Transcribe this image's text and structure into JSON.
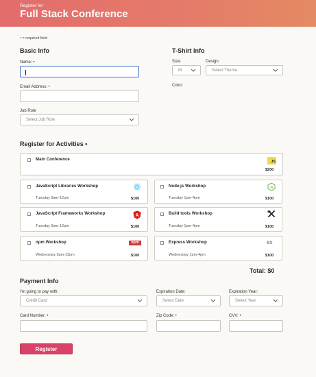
{
  "header": {
    "sup": "Register for",
    "title": "Full Stack Conference"
  },
  "required_note": "• = required field",
  "basic_info": {
    "heading": "Basic Info",
    "name_label": "Name: •",
    "name_value": "",
    "email_label": "Email Address: •",
    "email_value": "",
    "job_role_label": "Job Role",
    "job_role_selected": "Select Job Role"
  },
  "tshirt": {
    "heading": "T-Shirt Info",
    "size_label": "Size:",
    "size_selected": "M",
    "design_label": "Design:",
    "design_selected": "Select Theme",
    "color_label": "Color:"
  },
  "activities": {
    "heading": "Register for Activities •",
    "items": [
      {
        "name": "Main Conference",
        "time": "",
        "price": "$200",
        "logo": "JS",
        "logo_icon": "javascript-logo-icon"
      },
      {
        "name": "JavaScript Libraries Workshop",
        "time": "Tuesday 9am-12pm",
        "price": "$100",
        "logo": "",
        "logo_icon": "react-logo-icon"
      },
      {
        "name": "Node.js Workshop",
        "time": "Tuesday 1pm-4pm",
        "price": "$100",
        "logo": "JS",
        "logo_icon": "nodejs-logo-icon"
      },
      {
        "name": "JavaScript Frameworks Workshop",
        "time": "Tuesday 9am-12pm",
        "price": "$100",
        "logo": "A",
        "logo_icon": "angular-logo-icon"
      },
      {
        "name": "Build tools Workshop",
        "time": "Tuesday 1pm-4pm",
        "price": "$100",
        "logo": "",
        "logo_icon": "tools-icon"
      },
      {
        "name": "npm Workshop",
        "time": "Wednesday 9am-12pm",
        "price": "$100",
        "logo": "npm",
        "logo_icon": "npm-logo-icon"
      },
      {
        "name": "Express Workshop",
        "time": "Wednesday 1pm-4pm",
        "price": "$100",
        "logo": "ex",
        "logo_icon": "express-logo-icon"
      }
    ],
    "total": "Total: $0"
  },
  "payment": {
    "heading": "Payment Info",
    "method_label": "I'm going to pay with:",
    "method_selected": "Credit Card",
    "exp_date_label": "Expiration Date:",
    "exp_date_selected": "Select Date",
    "exp_year_label": "Expiration Year:",
    "exp_year_selected": "Select Year",
    "card_label": "Card Number: •",
    "zip_label": "Zip Code: •",
    "cvv_label": "CVV: •"
  },
  "register_button": "Register",
  "colors": {
    "accent": "#d94268",
    "header_start": "#e36c6c",
    "header_end": "#e48a62",
    "focus": "#3d6fc7"
  }
}
